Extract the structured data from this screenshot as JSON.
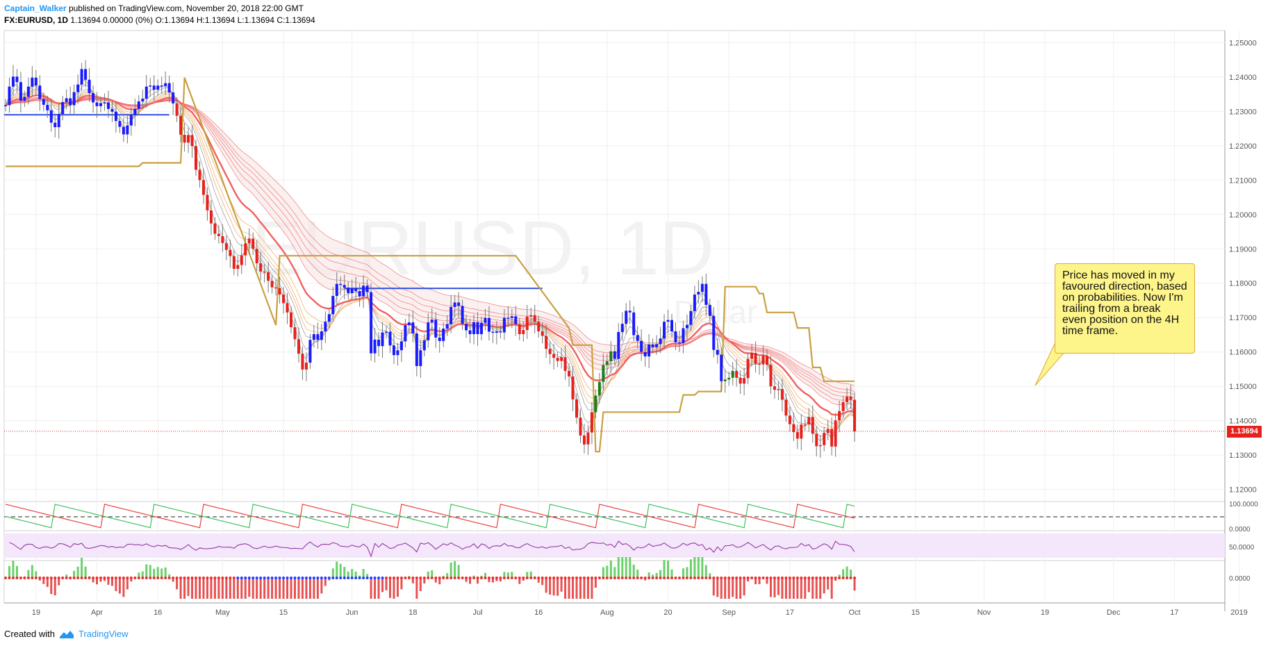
{
  "header": {
    "author": "Captain_Walker",
    "published": "published on TradingView.com, November 20, 2018 22:00 GMT",
    "symbol": "FX:EURUSD, 1D",
    "quote": "1.13694 0.00000 (0%)",
    "o": "O:1.13694",
    "h": "H:1.13694",
    "l": "L:1.13694",
    "c": "C:1.13694"
  },
  "watermark": {
    "symbol": "EURUSD, 1D",
    "name": "Dollar"
  },
  "callout_text": "Price has moved in my favoured direction, based on probabilities. Now I'm trailing from a break even position on the 4H time frame.",
  "price_tag": "1.13694",
  "footer": {
    "created_with": "Created with",
    "brand": "TradingView"
  },
  "colors": {
    "bull": "#1a7f1a",
    "bear": "#e8201c",
    "neutral": "#1a1aff",
    "trail": "#c8a040",
    "ma_red": "#f05a5a",
    "ma_green": "#6acf6a",
    "ma_gray": "#a0a0a0",
    "ma_orange": "#f0b070",
    "callout_bg": "#fdf48a",
    "level_line": "#3050e0",
    "last_price": "#e8201c"
  },
  "chart_data": {
    "type": "candlestick",
    "symbol": "FX:EURUSD",
    "timeframe": "1D",
    "price_axis": {
      "ticks": [
        "1.25000",
        "1.24000",
        "1.23000",
        "1.22000",
        "1.21000",
        "1.20000",
        "1.19000",
        "1.18000",
        "1.17000",
        "1.16000",
        "1.15000",
        "1.14000",
        "1.13000",
        "1.12000"
      ],
      "range": [
        1.1165,
        1.2535
      ]
    },
    "time_axis": {
      "ticks": [
        "19",
        "Apr",
        "16",
        "May",
        "15",
        "Jun",
        "18",
        "Jul",
        "16",
        "Aug",
        "20",
        "Sep",
        "17",
        "Oct",
        "15",
        "Nov",
        "19",
        "Dec",
        "17",
        "2019"
      ],
      "tick_bar_index": [
        8,
        24,
        40,
        57,
        73,
        91,
        107,
        124,
        140,
        158,
        174,
        190,
        206,
        223,
        239,
        257,
        273,
        291,
        307,
        324
      ],
      "last_bar_index": 275
    },
    "last_price": 1.13694,
    "candle_color_rule": "blue = neutral, red = bearish trend, green = bullish trend",
    "closes": [
      1.2318,
      1.2372,
      1.2401,
      1.2385,
      1.2331,
      1.2342,
      1.2372,
      1.2398,
      1.2375,
      1.2336,
      1.2319,
      1.2303,
      1.2267,
      1.2254,
      1.2292,
      1.2327,
      1.2338,
      1.2318,
      1.2356,
      1.2378,
      1.2423,
      1.2392,
      1.2353,
      1.2326,
      1.2315,
      1.2324,
      1.2326,
      1.2307,
      1.2299,
      1.2272,
      1.2255,
      1.2233,
      1.2259,
      1.229,
      1.2307,
      1.2329,
      1.2337,
      1.2372,
      1.2375,
      1.2363,
      1.2375,
      1.2373,
      1.2382,
      1.2355,
      1.2323,
      1.2287,
      1.2232,
      1.2209,
      1.2231,
      1.2199,
      1.213,
      1.21,
      1.2057,
      1.2012,
      1.1974,
      1.1944,
      1.1937,
      1.1917,
      1.1897,
      1.1879,
      1.1842,
      1.1853,
      1.1881,
      1.1916,
      1.193,
      1.19,
      1.1858,
      1.1834,
      1.1832,
      1.1807,
      1.1788,
      1.1786,
      1.1767,
      1.1742,
      1.1715,
      1.1672,
      1.1637,
      1.1595,
      1.1549,
      1.1569,
      1.1635,
      1.1652,
      1.1635,
      1.166,
      1.1688,
      1.171,
      1.1763,
      1.1798,
      1.1795,
      1.1787,
      1.1771,
      1.1785,
      1.1777,
      1.1762,
      1.1793,
      1.1774,
      1.1596,
      1.1636,
      1.1617,
      1.1657,
      1.1659,
      1.1619,
      1.1591,
      1.1605,
      1.1631,
      1.1678,
      1.1686,
      1.1654,
      1.1559,
      1.1605,
      1.1634,
      1.1686,
      1.1694,
      1.1642,
      1.1632,
      1.1668,
      1.1681,
      1.1731,
      1.1744,
      1.1734,
      1.1682,
      1.1663,
      1.1652,
      1.1687,
      1.1652,
      1.1685,
      1.1699,
      1.1659,
      1.1656,
      1.166,
      1.1657,
      1.1699,
      1.1699,
      1.1704,
      1.1681,
      1.1652,
      1.1664,
      1.1703,
      1.1707,
      1.1688,
      1.166,
      1.1647,
      1.1609,
      1.1594,
      1.1583,
      1.1574,
      1.1585,
      1.1545,
      1.1529,
      1.1462,
      1.1409,
      1.1357,
      1.1331,
      1.1366,
      1.1425,
      1.1473,
      1.1513,
      1.1562,
      1.1573,
      1.1602,
      1.158,
      1.1658,
      1.1682,
      1.172,
      1.1715,
      1.1649,
      1.1632,
      1.16,
      1.1587,
      1.1622,
      1.1614,
      1.1623,
      1.1639,
      1.1688,
      1.1693,
      1.166,
      1.1628,
      1.1626,
      1.1669,
      1.1679,
      1.1719,
      1.1767,
      1.1775,
      1.1798,
      1.1737,
      1.1705,
      1.1606,
      1.1592,
      1.1515,
      1.152,
      1.1525,
      1.1545,
      1.1525,
      1.1508,
      1.1524,
      1.158,
      1.1597,
      1.1566,
      1.1564,
      1.1589,
      1.1563,
      1.15,
      1.149,
      1.1492,
      1.1461,
      1.1415,
      1.139,
      1.1367,
      1.1348,
      1.1389,
      1.1389,
      1.1411,
      1.1362,
      1.1326,
      1.1329,
      1.1365,
      1.1376,
      1.1325,
      1.1401,
      1.1428,
      1.1454,
      1.147,
      1.1461,
      1.1369
    ]
  },
  "indicators": {
    "aroon": {
      "levels": [
        "100.0000",
        "0.0000"
      ]
    },
    "rsi": {
      "level": "50.0000"
    },
    "momentum": {
      "level": "0.0000"
    }
  }
}
